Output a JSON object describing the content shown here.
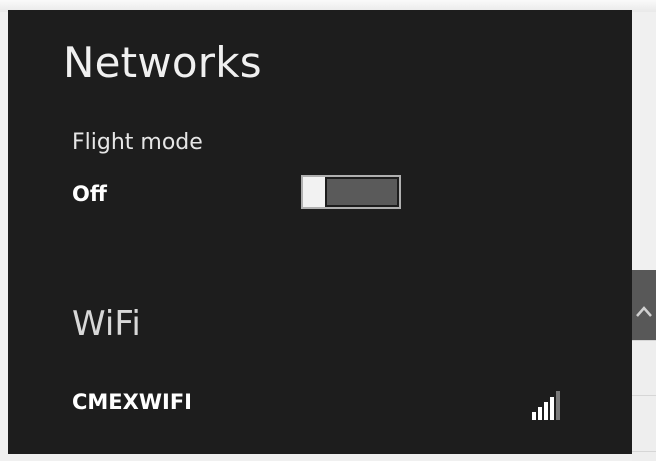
{
  "title": "Networks",
  "flight_mode": {
    "label": "Flight mode",
    "state": "Off",
    "on": false
  },
  "wifi": {
    "heading": "WiFi",
    "networks": [
      {
        "name": "CMEXWIFI",
        "signal_bars": 4,
        "signal_icon": "wifi-signal-icon"
      }
    ]
  },
  "scrollbar": {
    "arrow_icon": "chevron-up-icon"
  },
  "colors": {
    "panel_background": "#1d1d1d",
    "text": "#ffffff",
    "toggle_track": "#5a5a5a",
    "toggle_thumb": "#f2f2f2"
  }
}
